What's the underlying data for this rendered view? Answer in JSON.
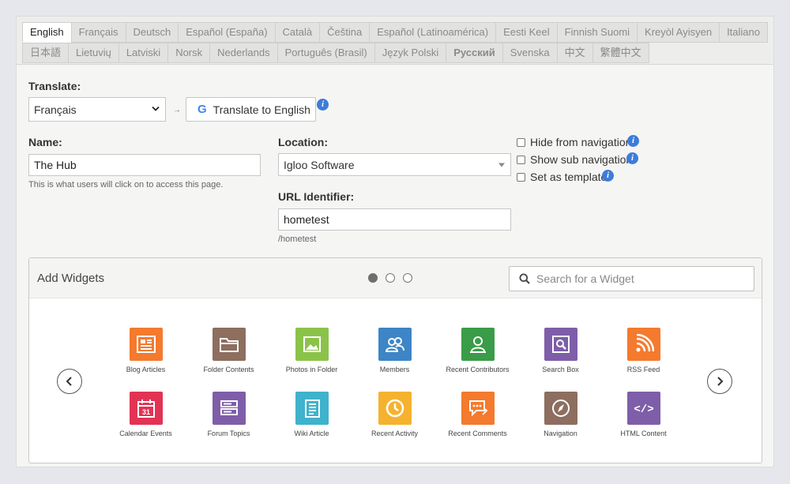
{
  "lang_tabs": {
    "row1": [
      "English",
      "Français",
      "Deutsch",
      "Español (España)",
      "Català",
      "Čeština",
      "Español (Latinoamérica)",
      "Eesti Keel",
      "Finnish Suomi",
      "Kreyòl Ayisyen",
      "Italiano"
    ],
    "row2": [
      "日本語",
      "Lietuvių",
      "Latviski",
      "Norsk",
      "Nederlands",
      "Português (Brasil)",
      "Język Polski",
      "Русский",
      "Svenska",
      "中文",
      "繁體中文"
    ],
    "active": "English"
  },
  "translate": {
    "label": "Translate:",
    "selected": "Français",
    "button_label": "Translate to English",
    "google_glyph": "G"
  },
  "name": {
    "label": "Name:",
    "value": "The Hub",
    "hint": "This is what users will click on to access this page."
  },
  "location": {
    "label": "Location:",
    "selected": "Igloo Software"
  },
  "url": {
    "label": "URL Identifier:",
    "value": "hometest",
    "hint": "/hometest"
  },
  "options": {
    "hide_from_navigation": "Hide from navigation",
    "show_sub_navigation": "Show sub navigation",
    "set_as_template": "Set as template",
    "info_glyph": "i"
  },
  "widgets": {
    "title": "Add Widgets",
    "search_placeholder": "Search for a Widget",
    "page_count": 3,
    "current_page": 1,
    "items": [
      {
        "label": "Blog Articles",
        "icon": "blog-articles-icon",
        "color": "#f47a2e"
      },
      {
        "label": "Folder Contents",
        "icon": "folder-icon",
        "color": "#8d6e5f"
      },
      {
        "label": "Photos in Folder",
        "icon": "photo-icon",
        "color": "#8bc34a"
      },
      {
        "label": "Members",
        "icon": "members-icon",
        "color": "#3d85c6"
      },
      {
        "label": "Recent Contributors",
        "icon": "contributor-icon",
        "color": "#3a9c48"
      },
      {
        "label": "Search Box",
        "icon": "search-box-icon",
        "color": "#7e5ea8"
      },
      {
        "label": "RSS Feed",
        "icon": "rss-icon",
        "color": "#f47a2e"
      },
      {
        "label": "Calendar Events",
        "icon": "calendar-icon",
        "color": "#e23355",
        "day": "31"
      },
      {
        "label": "Forum Topics",
        "icon": "forum-icon",
        "color": "#7e5ea8"
      },
      {
        "label": "Wiki Article",
        "icon": "wiki-icon",
        "color": "#3fb2cc"
      },
      {
        "label": "Recent Activity",
        "icon": "clock-icon",
        "color": "#f5b22e"
      },
      {
        "label": "Recent Comments",
        "icon": "comments-icon",
        "color": "#f47a2e"
      },
      {
        "label": "Navigation",
        "icon": "compass-icon",
        "color": "#8d6e5f"
      },
      {
        "label": "HTML Content",
        "icon": "code-icon",
        "color": "#7e5ea8",
        "glyph": "</>"
      }
    ]
  }
}
